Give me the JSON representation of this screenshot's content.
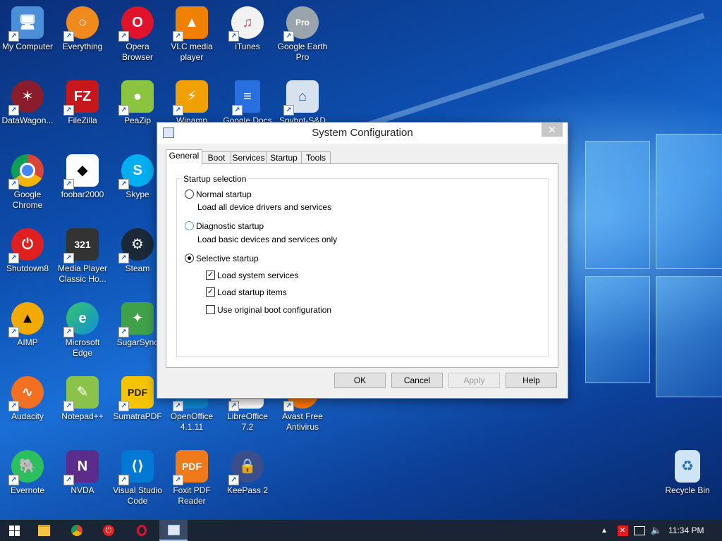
{
  "desktop": {
    "icons": [
      {
        "label": "My Computer",
        "icon": "computer-icon",
        "color": "#4a8fd8"
      },
      {
        "label": "Everything",
        "icon": "everything-icon",
        "color": "#f08a1c"
      },
      {
        "label": "Opera Browser",
        "icon": "opera-icon",
        "color": "#e0132b"
      },
      {
        "label": "VLC media player",
        "icon": "vlc-icon",
        "color": "#f08000"
      },
      {
        "label": "iTunes",
        "icon": "itunes-icon",
        "color": "#f2f2f2"
      },
      {
        "label": "Google Earth Pro",
        "icon": "google-earth-icon",
        "color": "#9aa4ad"
      },
      {
        "label": "DataWagon...",
        "icon": "datawagon-icon",
        "color": "#8a1c2c"
      },
      {
        "label": "FileZilla",
        "icon": "filezilla-icon",
        "color": "#c8161d"
      },
      {
        "label": "PeaZip",
        "icon": "peazip-icon",
        "color": "#8bc53f"
      },
      {
        "label": "Winamp",
        "icon": "winamp-icon",
        "color": "#f0a000"
      },
      {
        "label": "Google Docs",
        "icon": "google-docs-icon",
        "color": "#2a6fe0"
      },
      {
        "label": "Spybot-S&D",
        "icon": "spybot-icon",
        "color": "#d8e2ee"
      },
      {
        "label": "Google Chrome",
        "icon": "chrome-icon",
        "color": "#db4437"
      },
      {
        "label": "foobar2000",
        "icon": "foobar-icon",
        "color": "#ffffff"
      },
      {
        "label": "Skype",
        "icon": "skype-icon",
        "color": "#00aff0"
      },
      {
        "label": "Shutdown8",
        "icon": "power-icon",
        "color": "#e02020"
      },
      {
        "label": "Media Player Classic Ho...",
        "icon": "mpc-hc-icon",
        "color": "#333333"
      },
      {
        "label": "Steam",
        "icon": "steam-icon",
        "color": "#1b2838"
      },
      {
        "label": "AIMP",
        "icon": "aimp-icon",
        "color": "#f2a900"
      },
      {
        "label": "Microsoft Edge",
        "icon": "edge-icon",
        "color": "#0f8fd8"
      },
      {
        "label": "SugarSync",
        "icon": "sugarsync-icon",
        "color": "#3fa24a"
      },
      {
        "label": "Audacity",
        "icon": "audacity-icon",
        "color": "#f37021"
      },
      {
        "label": "Notepad++",
        "icon": "notepadpp-icon",
        "color": "#8bc34a"
      },
      {
        "label": "SumatraPDF",
        "icon": "sumatrapdf-icon",
        "color": "#f5c400"
      },
      {
        "label": "OpenOffice 4.1.11",
        "icon": "openoffice-icon",
        "color": "#0e85cd"
      },
      {
        "label": "LibreOffice 7.2",
        "icon": "libreoffice-icon",
        "color": "#ffffff"
      },
      {
        "label": "Avast Free Antivirus",
        "icon": "avast-icon",
        "color": "#ff7800"
      },
      {
        "label": "Evernote",
        "icon": "evernote-icon",
        "color": "#2dbe60"
      },
      {
        "label": "NVDA",
        "icon": "nvda-icon",
        "color": "#5b2c8a"
      },
      {
        "label": "Visual Studio Code",
        "icon": "vscode-icon",
        "color": "#0078d4"
      },
      {
        "label": "Foxit PDF Reader",
        "icon": "foxit-icon",
        "color": "#f07a1a"
      },
      {
        "label": "KeePass 2",
        "icon": "keepass-icon",
        "color": "#3a4e8c"
      },
      {
        "label": "Recycle Bin",
        "icon": "recycle-bin-icon",
        "color": "#cfe4f5"
      }
    ]
  },
  "dialog": {
    "title": "System Configuration",
    "close_symbol": "✕",
    "tabs": [
      "General",
      "Boot",
      "Services",
      "Startup",
      "Tools"
    ],
    "active_tab": "General",
    "group_title": "Startup selection",
    "options": {
      "normal": {
        "label": "Normal startup",
        "desc": "Load all device drivers and services",
        "selected": false
      },
      "diagnostic": {
        "label": "Diagnostic startup",
        "desc": "Load basic devices and services only",
        "selected": false
      },
      "selective": {
        "label": "Selective startup",
        "selected": true
      }
    },
    "checks": {
      "system_services": {
        "label": "Load system services",
        "checked": true
      },
      "startup_items": {
        "label": "Load startup items",
        "checked": true
      },
      "original_boot": {
        "label": "Use original boot configuration",
        "checked": false
      }
    },
    "buttons": {
      "ok": "OK",
      "cancel": "Cancel",
      "apply": "Apply",
      "help": "Help"
    },
    "apply_enabled": false
  },
  "taskbar": {
    "items": [
      "start-icon",
      "file-explorer-icon",
      "chrome-icon",
      "shutdown8-icon",
      "opera-icon",
      "system-config-icon"
    ],
    "active_item": "system-config-icon",
    "clock": "11:34 PM"
  }
}
